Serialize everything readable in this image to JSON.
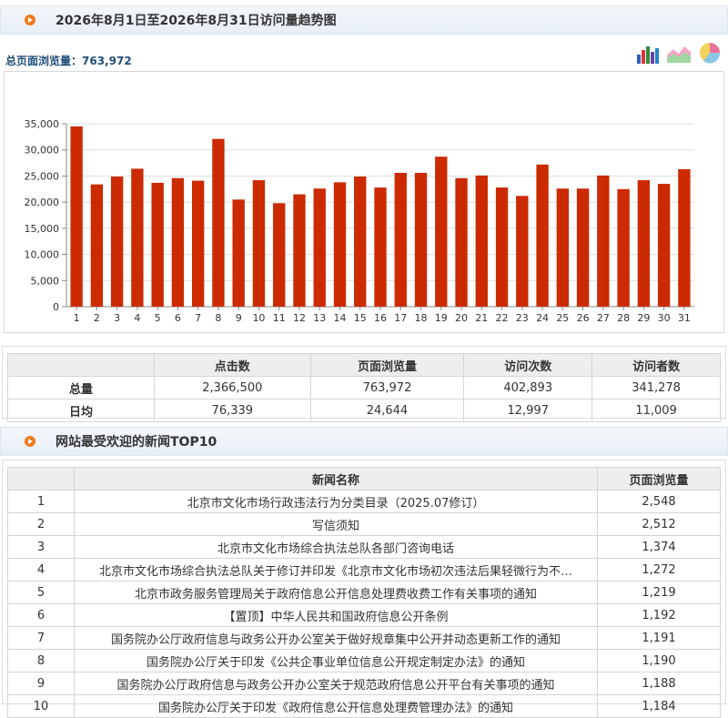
{
  "header": {
    "title": "2026年8月1日至2026年8月31日访问量趋势图"
  },
  "summary": {
    "label": "总页面浏览量：",
    "value": "763,972"
  },
  "icons": [
    "bar-chart-icon",
    "area-chart-icon",
    "pie-chart-icon"
  ],
  "chart_data": {
    "type": "bar",
    "categories": [
      "1",
      "2",
      "3",
      "4",
      "5",
      "6",
      "7",
      "8",
      "9",
      "10",
      "11",
      "12",
      "13",
      "14",
      "15",
      "16",
      "17",
      "18",
      "19",
      "20",
      "21",
      "22",
      "23",
      "24",
      "25",
      "26",
      "27",
      "28",
      "29",
      "30",
      "31"
    ],
    "values": [
      34500,
      23400,
      24900,
      26400,
      23700,
      24600,
      24100,
      32100,
      20500,
      24200,
      19800,
      21500,
      22600,
      23800,
      24900,
      22800,
      25600,
      25600,
      28700,
      24600,
      25100,
      22800,
      21200,
      27200,
      22600,
      22600,
      25100,
      22500,
      24200,
      23500,
      26300
    ],
    "yticks": [
      "0",
      "5,000",
      "10,000",
      "15,000",
      "20,000",
      "25,000",
      "30,000",
      "35,000"
    ],
    "ylim": [
      0,
      35000
    ],
    "color": "#cc2a00"
  },
  "stats": {
    "headers": [
      "",
      "点击数",
      "页面浏览量",
      "访问次数",
      "访问者数"
    ],
    "rows": [
      {
        "label": "总量",
        "values": [
          "2,366,500",
          "763,972",
          "402,893",
          "341,278"
        ]
      },
      {
        "label": "日均",
        "values": [
          "76,339",
          "24,644",
          "12,997",
          "11,009"
        ]
      }
    ]
  },
  "top": {
    "title": "网站最受欢迎的新闻TOP10",
    "headers": [
      "",
      "新闻名称",
      "页面浏览量"
    ],
    "rows": [
      {
        "rank": "1",
        "name": "北京市文化市场行政违法行为分类目录（2025.07修订）",
        "views": "2,548"
      },
      {
        "rank": "2",
        "name": "写信须知",
        "views": "2,512"
      },
      {
        "rank": "3",
        "name": "北京市文化市场综合执法总队各部门咨询电话",
        "views": "1,374"
      },
      {
        "rank": "4",
        "name": "北京市文化市场综合执法总队关于修订并印发《北京市文化市场初次违法后果轻微行为不…",
        "views": "1,272"
      },
      {
        "rank": "5",
        "name": "北京市政务服务管理局关于政府信息公开信息处理费收费工作有关事项的通知",
        "views": "1,219"
      },
      {
        "rank": "6",
        "name": "【置顶】中华人民共和国政府信息公开条例",
        "views": "1,192"
      },
      {
        "rank": "7",
        "name": "国务院办公厅政府信息与政务公开办公室关于做好规章集中公开并动态更新工作的通知",
        "views": "1,191"
      },
      {
        "rank": "8",
        "name": "国务院办公厅关于印发《公共企事业单位信息公开规定制定办法》的通知",
        "views": "1,190"
      },
      {
        "rank": "9",
        "name": "国务院办公厅政府信息与政务公开办公室关于规范政府信息公开平台有关事项的通知",
        "views": "1,188"
      },
      {
        "rank": "10",
        "name": "国务院办公厅关于印发《政府信息公开信息处理费管理办法》的通知",
        "views": "1,184"
      }
    ]
  }
}
